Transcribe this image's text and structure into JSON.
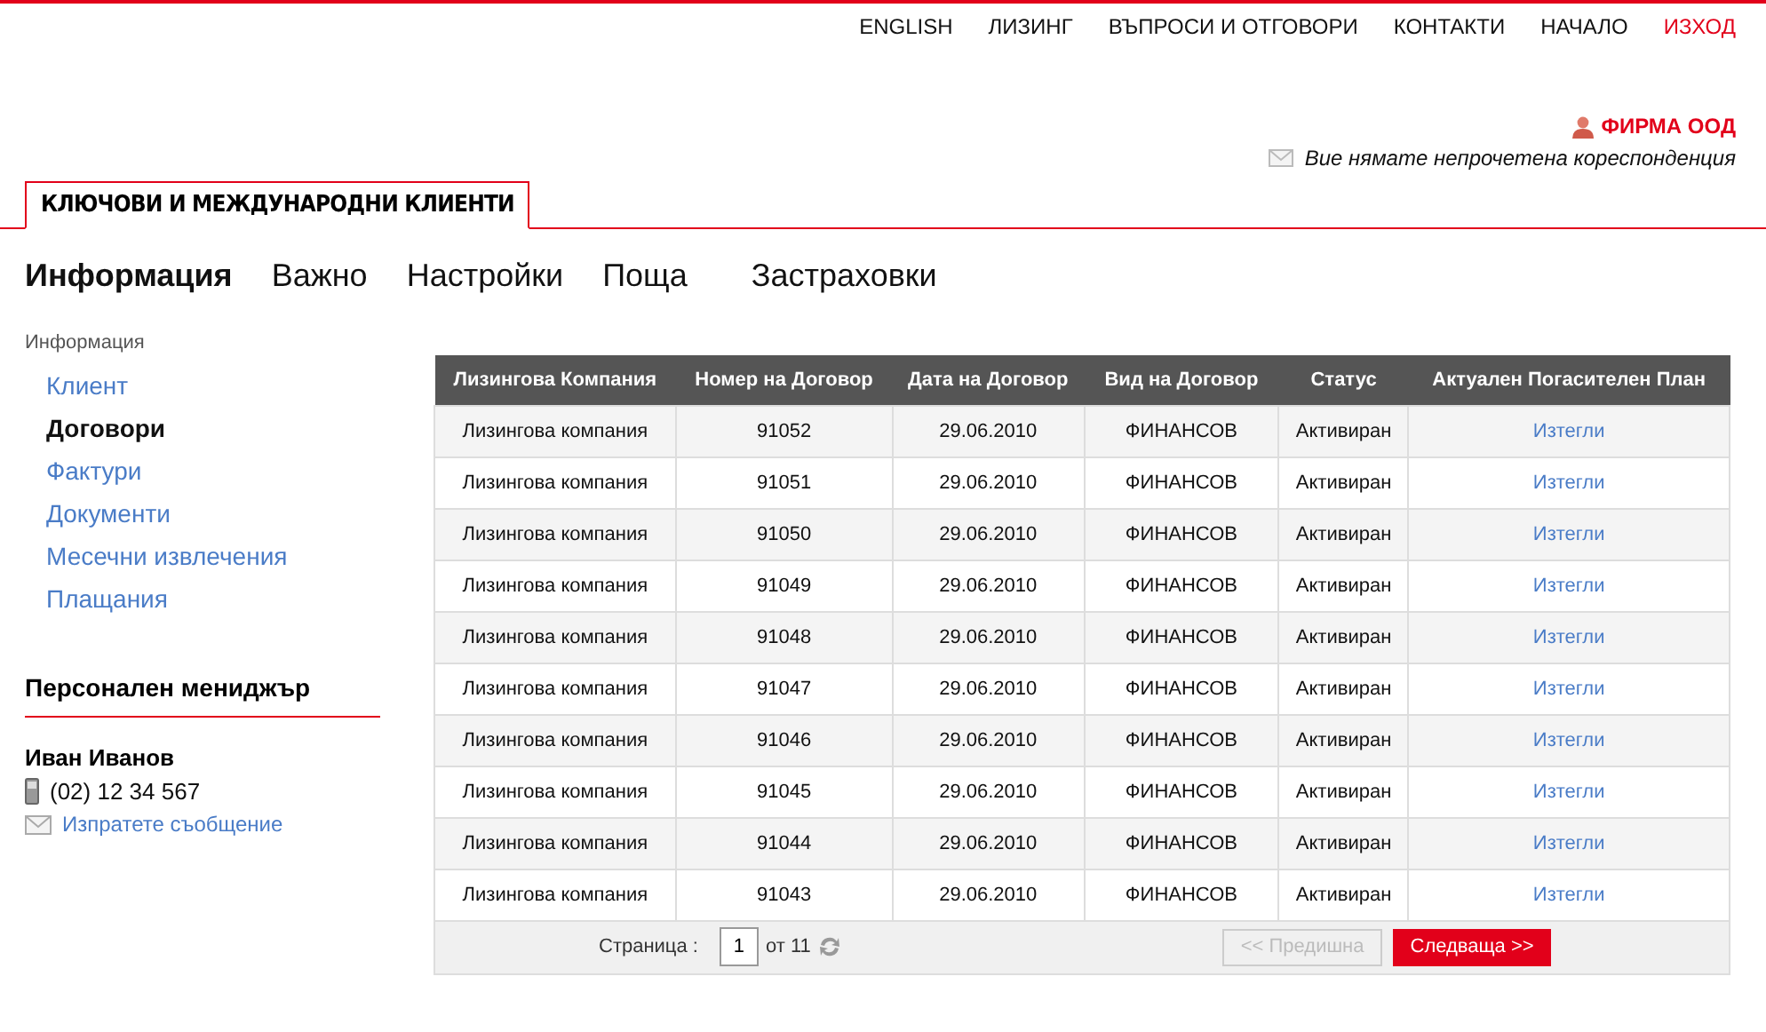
{
  "top_nav": [
    {
      "label": "ENGLISH",
      "kind": "link"
    },
    {
      "label": "ЛИЗИНГ",
      "kind": "link"
    },
    {
      "label": "ВЪПРОСИ И ОТГОВОРИ",
      "kind": "link"
    },
    {
      "label": "КОНТАКТИ",
      "kind": "link"
    },
    {
      "label": "НАЧАЛО",
      "kind": "link"
    },
    {
      "label": "ИЗХОД",
      "kind": "exit"
    }
  ],
  "user": {
    "name": "ФИРМА ООД",
    "mail_notice": "Вие нямате непрочетена кореспонденция"
  },
  "section_tab": "КЛЮЧОВИ И МЕЖДУНАРОДНИ КЛИЕНТИ",
  "main_nav": [
    {
      "label": "Информация",
      "selected": true
    },
    {
      "label": "Важно",
      "selected": false
    },
    {
      "label": "Настройки",
      "selected": false
    },
    {
      "label": "Поща",
      "selected": false
    },
    {
      "label": "Застраховки",
      "selected": false
    }
  ],
  "sidebar": {
    "heading": "Информация",
    "items": [
      {
        "label": "Клиент",
        "selected": false
      },
      {
        "label": "Договори",
        "selected": true
      },
      {
        "label": "Фактури",
        "selected": false
      },
      {
        "label": "Документи",
        "selected": false
      },
      {
        "label": "Месечни извлечения",
        "selected": false
      },
      {
        "label": "Плащания",
        "selected": false
      }
    ]
  },
  "manager": {
    "heading": "Персонален мениджър",
    "name": "Иван Иванов",
    "phone": "(02) 12 34 567",
    "message_link": "Изпратете съобщение"
  },
  "table": {
    "columns": [
      "Лизингова Компания",
      "Номер на Договор",
      "Дата на Договор",
      "Вид на Договор",
      "Статус",
      "Актуален Погасителен План"
    ],
    "rows": [
      [
        "Лизингова компания",
        "91052",
        "29.06.2010",
        "ФИНАНСОВ",
        "Активиран",
        "Изтегли"
      ],
      [
        "Лизингова компания",
        "91051",
        "29.06.2010",
        "ФИНАНСОВ",
        "Активиран",
        "Изтегли"
      ],
      [
        "Лизингова компания",
        "91050",
        "29.06.2010",
        "ФИНАНСОВ",
        "Активиран",
        "Изтегли"
      ],
      [
        "Лизингова компания",
        "91049",
        "29.06.2010",
        "ФИНАНСОВ",
        "Активиран",
        "Изтегли"
      ],
      [
        "Лизингова компания",
        "91048",
        "29.06.2010",
        "ФИНАНСОВ",
        "Активиран",
        "Изтегли"
      ],
      [
        "Лизингова компания",
        "91047",
        "29.06.2010",
        "ФИНАНСОВ",
        "Активиран",
        "Изтегли"
      ],
      [
        "Лизингова компания",
        "91046",
        "29.06.2010",
        "ФИНАНСОВ",
        "Активиран",
        "Изтегли"
      ],
      [
        "Лизингова компания",
        "91045",
        "29.06.2010",
        "ФИНАНСОВ",
        "Активиран",
        "Изтегли"
      ],
      [
        "Лизингова компания",
        "91044",
        "29.06.2010",
        "ФИНАНСОВ",
        "Активиран",
        "Изтегли"
      ],
      [
        "Лизингова компания",
        "91043",
        "29.06.2010",
        "ФИНАНСОВ",
        "Активиран",
        "Изтегли"
      ]
    ]
  },
  "pager": {
    "label": "Страница :",
    "page": "1",
    "total": "от 11",
    "prev": {
      "label": "<< Предишна",
      "disabled": true
    },
    "next": {
      "label": "Следваща >>",
      "disabled": false
    }
  }
}
